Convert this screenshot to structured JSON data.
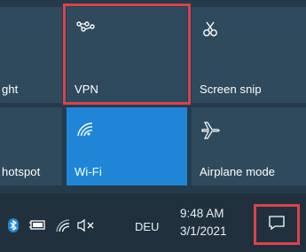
{
  "quick_actions": {
    "row1": [
      {
        "label": "ght",
        "icon": "night-light-icon"
      },
      {
        "label": "VPN",
        "icon": "vpn-icon"
      },
      {
        "label": "Screen snip",
        "icon": "screen-snip-icon"
      }
    ],
    "row2": [
      {
        "label": "hotspot",
        "icon": "mobile-hotspot-icon"
      },
      {
        "label": "Wi-Fi",
        "icon": "wifi-icon"
      },
      {
        "label": "Airplane mode",
        "icon": "airplane-icon"
      }
    ]
  },
  "taskbar": {
    "language": "DEU",
    "time": "9:48 AM",
    "date": "3/1/2021"
  },
  "colors": {
    "active_tile": "#1f86d7",
    "highlight_border": "#d9434e"
  }
}
